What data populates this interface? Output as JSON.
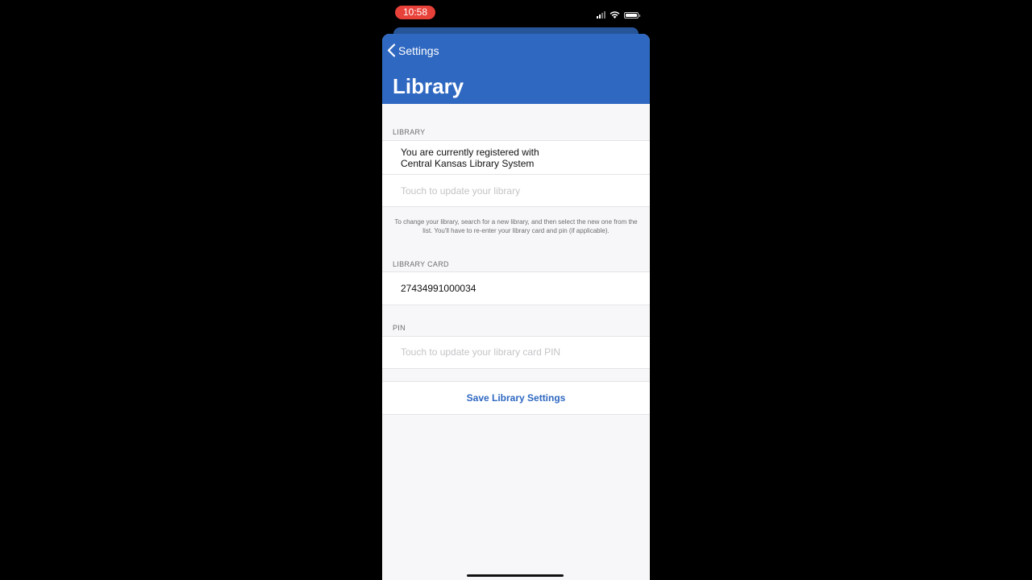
{
  "status_bar": {
    "time": "10:58",
    "icons": [
      "cellular-signal-icon",
      "wifi-icon",
      "battery-icon"
    ]
  },
  "colors": {
    "nav_blue": "#2f68c1",
    "time_pill": "#e8413a",
    "save_text": "#2f68c1"
  },
  "nav": {
    "back_label": "Settings",
    "title": "Library"
  },
  "library_section": {
    "header": "LIBRARY",
    "registered_line1": "You are currently registered with",
    "registered_line2": "Central Kansas Library System",
    "update_placeholder": "Touch to update your library",
    "note": "To change your library, search for a new library, and then select the new one from the list. You'll have to re-enter your library card and pin (if applicable)."
  },
  "card_section": {
    "header": "LIBRARY CARD",
    "value": "27434991000034"
  },
  "pin_section": {
    "header": "PIN",
    "placeholder": "Touch to update your library card PIN"
  },
  "save_button": {
    "label": "Save Library Settings"
  }
}
